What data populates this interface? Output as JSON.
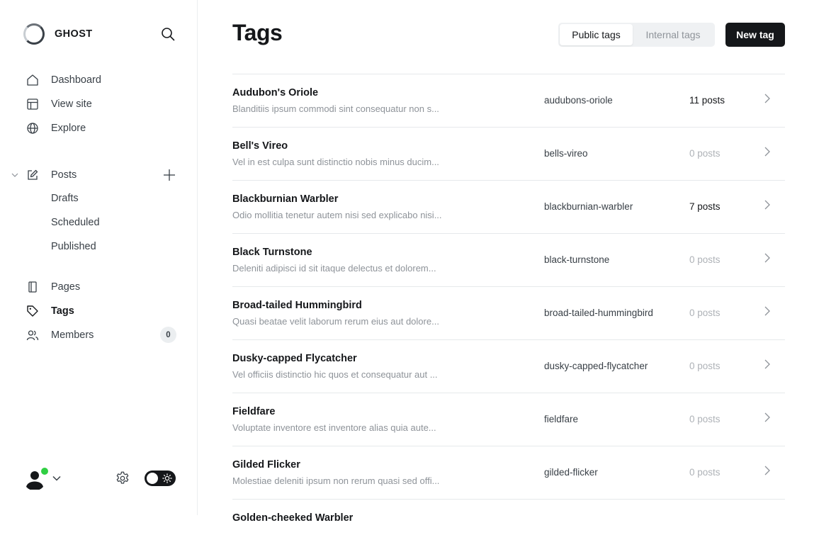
{
  "app": {
    "brand": "GHOST"
  },
  "sidebar": {
    "nav": [
      {
        "label": "Dashboard",
        "icon": "home-icon"
      },
      {
        "label": "View site",
        "icon": "layout-icon"
      },
      {
        "label": "Explore",
        "icon": "globe-icon"
      }
    ],
    "posts": {
      "label": "Posts",
      "icon": "edit-icon",
      "subitems": [
        "Drafts",
        "Scheduled",
        "Published"
      ]
    },
    "nav2": [
      {
        "label": "Pages",
        "icon": "page-icon"
      },
      {
        "label": "Tags",
        "icon": "tag-icon",
        "active": true
      },
      {
        "label": "Members",
        "icon": "members-icon",
        "count": "0"
      }
    ]
  },
  "header": {
    "title": "Tags",
    "segments": [
      "Public tags",
      "Internal tags"
    ],
    "active_segment": "Public tags",
    "new_tag_label": "New tag"
  },
  "tags": [
    {
      "name": "Audubon's Oriole",
      "description": "Blanditiis ipsum commodi sint consequatur non s...",
      "slug": "audubons-oriole",
      "count": "11 posts",
      "has_posts": true
    },
    {
      "name": "Bell's Vireo",
      "description": "Vel in est culpa sunt distinctio nobis minus ducim...",
      "slug": "bells-vireo",
      "count": "0 posts",
      "has_posts": false
    },
    {
      "name": "Blackburnian Warbler",
      "description": "Odio mollitia tenetur autem nisi sed explicabo nisi...",
      "slug": "blackburnian-warbler",
      "count": "7 posts",
      "has_posts": true
    },
    {
      "name": "Black Turnstone",
      "description": "Deleniti adipisci id sit itaque delectus et dolorem...",
      "slug": "black-turnstone",
      "count": "0 posts",
      "has_posts": false
    },
    {
      "name": "Broad-tailed Hummingbird",
      "description": "Quasi beatae velit laborum rerum eius aut dolore...",
      "slug": "broad-tailed-hummingbird",
      "count": "0 posts",
      "has_posts": false
    },
    {
      "name": "Dusky-capped Flycatcher",
      "description": "Vel officiis distinctio hic quos et consequatur aut ...",
      "slug": "dusky-capped-flycatcher",
      "count": "0 posts",
      "has_posts": false
    },
    {
      "name": "Fieldfare",
      "description": "Voluptate inventore est inventore alias quia aute...",
      "slug": "fieldfare",
      "count": "0 posts",
      "has_posts": false
    },
    {
      "name": "Gilded Flicker",
      "description": "Molestiae deleniti ipsum non rerum quasi sed offi...",
      "slug": "gilded-flicker",
      "count": "0 posts",
      "has_posts": false
    },
    {
      "name": "Golden-cheeked Warbler",
      "description": "",
      "slug": "",
      "count": "",
      "has_posts": false
    }
  ],
  "colors": {
    "accent_dark": "#15171a",
    "online": "#30cf43",
    "muted": "#8e9399"
  }
}
